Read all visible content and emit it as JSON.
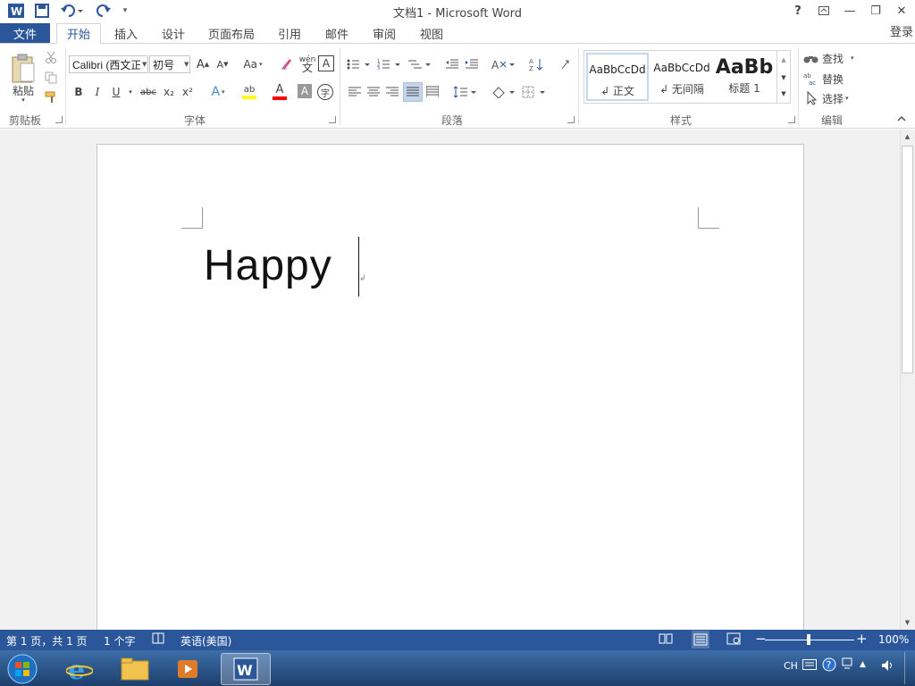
{
  "titlebar": {
    "title": "文档1 - Microsoft Word",
    "help": "?",
    "ribbon_display": "⊼",
    "minimize": "—",
    "restore": "❐",
    "close": "✕"
  },
  "qat": {
    "app_icon": "W",
    "save_icon": "save-icon",
    "undo_icon": "undo-icon",
    "redo_icon": "redo-icon"
  },
  "tabs": {
    "file": "文件",
    "items": [
      "开始",
      "插入",
      "设计",
      "页面布局",
      "引用",
      "邮件",
      "审阅",
      "视图"
    ],
    "login": "登录"
  },
  "clipboard": {
    "paste": "粘贴",
    "group": "剪贴板"
  },
  "font": {
    "name": "Calibri (西文正",
    "size": "初号",
    "grow": "A",
    "shrink": "A",
    "case": "Aa",
    "pinyin": "wén",
    "border_char": "A",
    "bold": "B",
    "italic": "I",
    "underline": "U",
    "strike": "abc",
    "subscript": "x₂",
    "superscript": "x²",
    "effects": "A",
    "highlight": "ab",
    "color": "A",
    "shade": "A",
    "circle": "字",
    "group": "字体",
    "highlight_color": "#ffff00",
    "font_color": "#ff0000"
  },
  "paragraph": {
    "group": "段落"
  },
  "styles": {
    "items": [
      {
        "preview": "AaBbCcDd",
        "name": "↲ 正文"
      },
      {
        "preview": "AaBbCcDd",
        "name": "↲ 无间隔"
      },
      {
        "preview": "AaBb",
        "name": "标题 1"
      }
    ],
    "group": "样式"
  },
  "editing": {
    "find": "查找",
    "replace": "替换",
    "select": "选择",
    "group": "编辑"
  },
  "document": {
    "text": "Happy"
  },
  "statusbar": {
    "page": "第 1 页，共 1 页",
    "words": "1 个字",
    "language": "英语(美国)",
    "zoom": "100%",
    "minus": "−",
    "plus": "+"
  },
  "taskbar": {
    "tray_lang": "CH"
  },
  "colors": {
    "accent": "#2b579a"
  }
}
